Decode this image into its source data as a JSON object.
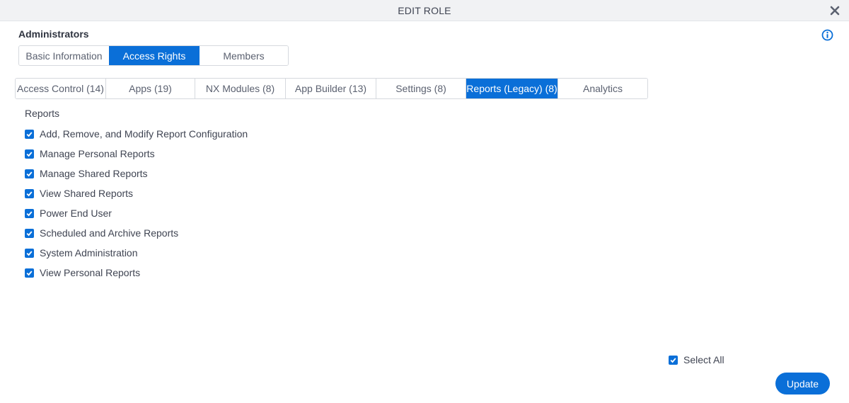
{
  "dialog": {
    "title": "EDIT ROLE",
    "close_icon": "close-icon",
    "info_icon": "info-icon"
  },
  "role": {
    "name": "Administrators"
  },
  "main_tabs": [
    {
      "label": "Basic Information",
      "active": false
    },
    {
      "label": "Access Rights",
      "active": true
    },
    {
      "label": "Members",
      "active": false
    }
  ],
  "sub_tabs": [
    {
      "label": "Access Control (14)",
      "active": false
    },
    {
      "label": "Apps (19)",
      "active": false
    },
    {
      "label": "NX Modules (8)",
      "active": false
    },
    {
      "label": "App Builder (13)",
      "active": false
    },
    {
      "label": "Settings (8)",
      "active": false
    },
    {
      "label": "Reports (Legacy) (8)",
      "active": true
    },
    {
      "label": "Analytics",
      "active": false
    }
  ],
  "section": {
    "label": "Reports",
    "permissions": [
      {
        "label": "Add, Remove, and Modify Report Configuration",
        "checked": true
      },
      {
        "label": "Manage Personal Reports",
        "checked": true
      },
      {
        "label": "Manage Shared Reports",
        "checked": true
      },
      {
        "label": "View Shared Reports",
        "checked": true
      },
      {
        "label": "Power End User",
        "checked": true
      },
      {
        "label": "Scheduled and Archive Reports",
        "checked": true
      },
      {
        "label": "System Administration",
        "checked": true
      },
      {
        "label": "View Personal Reports",
        "checked": true
      }
    ]
  },
  "footer": {
    "select_all_label": "Select All",
    "select_all_checked": true,
    "update_label": "Update"
  },
  "colors": {
    "accent": "#0a6fd8",
    "title_bar": "#f1f2f4",
    "text": "#3f4452"
  }
}
